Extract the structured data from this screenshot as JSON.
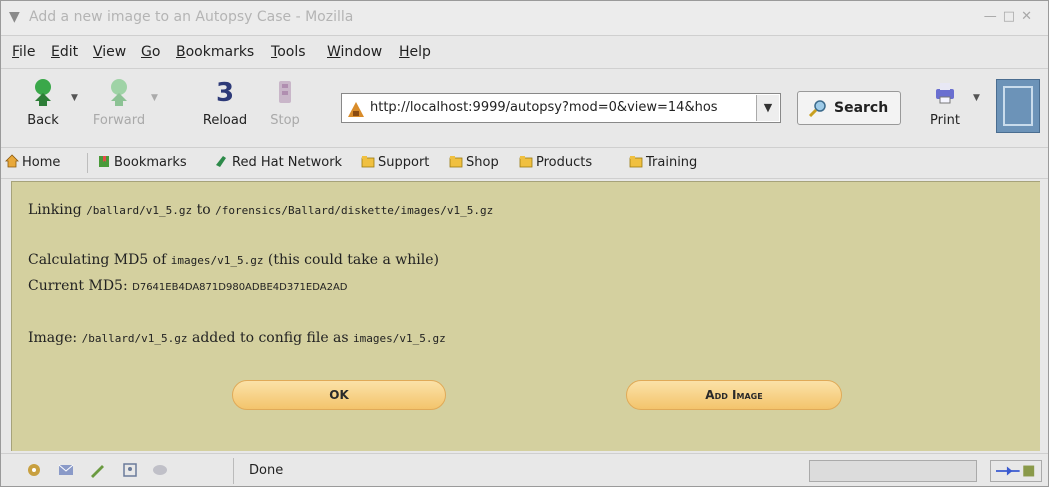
{
  "window": {
    "title": "Add a new image to an Autopsy Case - Mozilla"
  },
  "menu": {
    "items": [
      "File",
      "Edit",
      "View",
      "Go",
      "Bookmarks",
      "Tools",
      "Window",
      "Help"
    ]
  },
  "nav": {
    "back": "Back",
    "forward": "Forward",
    "reload": "Reload",
    "stop": "Stop",
    "url": "http://localhost:9999/autopsy?mod=0&view=14&hos",
    "search": "Search",
    "print": "Print"
  },
  "personal_toolbar": {
    "items": [
      "Home",
      "Bookmarks",
      "Red Hat Network",
      "Support",
      "Shop",
      "Products",
      "Training"
    ]
  },
  "content": {
    "line1": {
      "prefix": "Linking ",
      "src": "/ballard/v1_5.gz",
      "mid": " to ",
      "dst": "/forensics/Ballard/diskette/images/v1_5.gz"
    },
    "line2": {
      "prefix": "Calculating MD5 of ",
      "path": "images/v1_5.gz",
      "suffix": " (this could take a while)"
    },
    "line3": {
      "prefix": "Current MD5: ",
      "hash": "D7641EB4DA871D980ADBE4D371EDA2AD"
    },
    "line4": {
      "prefix": "Image: ",
      "path": "/ballard/v1_5.gz",
      "mid": " added to config file as ",
      "dest": "images/v1_5.gz"
    },
    "ok_button": "OK",
    "add_image_button": "Add Image"
  },
  "status": {
    "text": "Done"
  },
  "colors": {
    "content_bg": "#d4d09f",
    "button_fill": "#f3c46c"
  }
}
